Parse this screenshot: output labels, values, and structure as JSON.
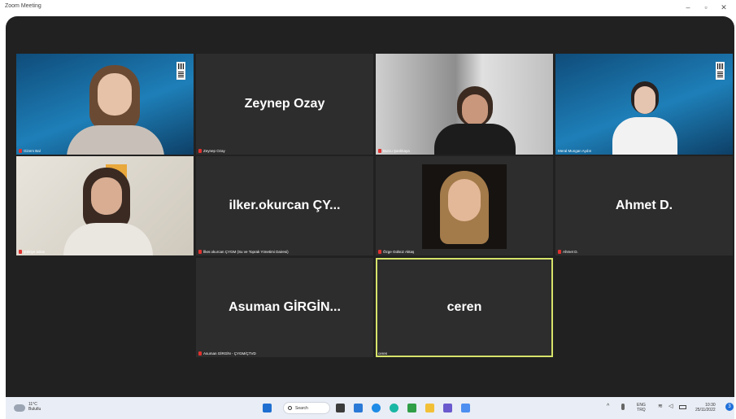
{
  "window": {
    "title": "Zoom Meeting",
    "minimize": "–",
    "maximize": "▫",
    "close": "✕"
  },
  "participants": [
    {
      "caption": "Gizem Bal",
      "big_name": "",
      "muted": true
    },
    {
      "caption": "Zeynep Ozay",
      "big_name": "Zeynep Ozay",
      "muted": true
    },
    {
      "caption": "Burcu Şanlıkaya",
      "big_name": "",
      "muted": true
    },
    {
      "caption": "Meral Mungan Aydın",
      "big_name": "",
      "muted": false
    },
    {
      "caption": "şükriye aslan",
      "big_name": "",
      "muted": true
    },
    {
      "caption": "İlker.okurcan ÇYGM (Su ve Toprak Yönetimi Dairesi)",
      "big_name": "ilker.okurcan ÇY...",
      "muted": true
    },
    {
      "caption": "Özge Gülsüz Aktaş",
      "big_name": "",
      "muted": true
    },
    {
      "caption": "Ahmet D.",
      "big_name": "Ahmet D.",
      "muted": true
    },
    {
      "caption": "Asuman GİRGİN - ÇYGM/ÇTVD",
      "big_name": "Asuman GİRGİN...",
      "muted": true
    },
    {
      "caption": "ceren",
      "big_name": "ceren",
      "muted": false
    }
  ],
  "taskbar": {
    "weather_temp": "11°C",
    "weather_desc": "Bulutlu",
    "search_label": "Search",
    "lang_top": "ENG",
    "lang_bottom": "TRQ",
    "time": "10:30",
    "date": "25/11/2022",
    "notification_count": "3"
  },
  "colors": {
    "meeting_bg": "#212121",
    "tile_bg": "#2d2d2d",
    "active_speaker_border": "#d6e36a",
    "muted_icon": "#e0322f",
    "taskbar_bg": "#e9edf5"
  }
}
